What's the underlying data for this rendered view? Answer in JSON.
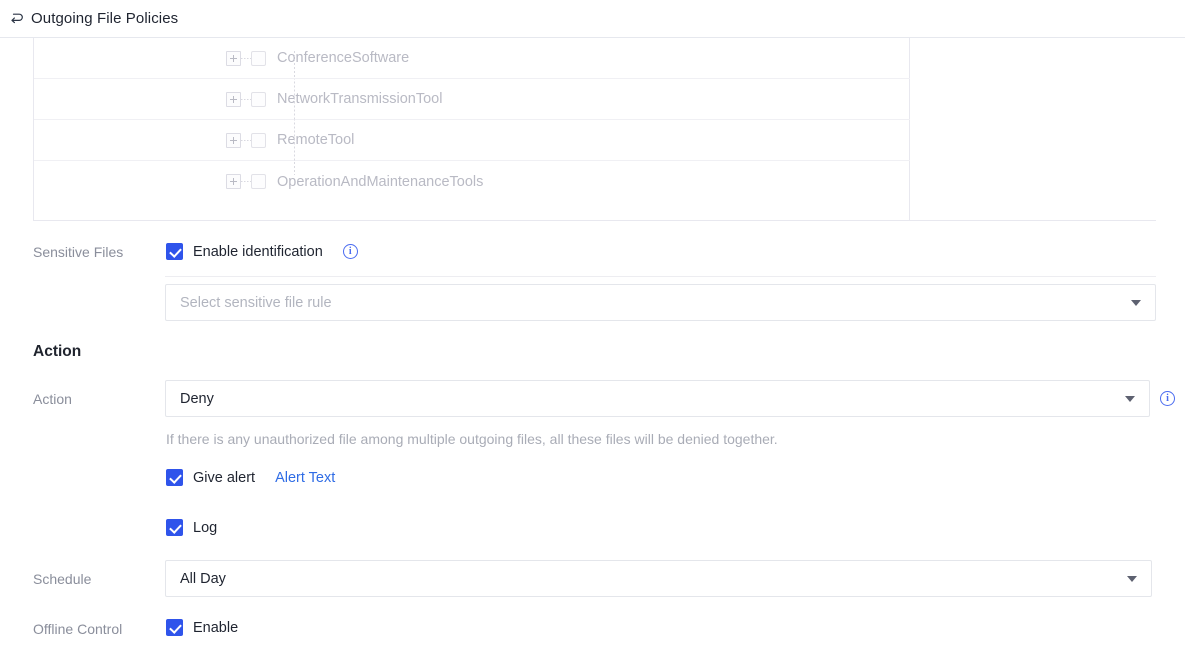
{
  "header": {
    "back_icon": "back-arrow-icon",
    "title": "Outgoing File Policies"
  },
  "tree": {
    "items": [
      {
        "label": "ConferenceSoftware",
        "expander": "plus-icon",
        "checked": false
      },
      {
        "label": "NetworkTransmissionTool",
        "expander": "plus-icon",
        "checked": false
      },
      {
        "label": "RemoteTool",
        "expander": "plus-icon",
        "checked": false
      },
      {
        "label": "OperationAndMaintenanceTools",
        "expander": "plus-icon",
        "checked": false
      }
    ]
  },
  "form": {
    "sensitive_files": {
      "label": "Sensitive Files",
      "enable_identification_label": "Enable identification",
      "enable_identification_checked": true,
      "info_icon": "info-icon",
      "rule_select_placeholder": "Select sensitive file rule",
      "rule_select_value": ""
    },
    "action_section": {
      "section_title": "Action",
      "label": "Action",
      "value": "Deny",
      "info_icon": "info-icon",
      "help_text": "If there is any unauthorized file among multiple outgoing files, all these files will be denied together.",
      "give_alert_label": "Give alert",
      "give_alert_checked": true,
      "alert_text_link": "Alert Text",
      "log_label": "Log",
      "log_checked": true
    },
    "schedule": {
      "label": "Schedule",
      "value": "All Day"
    },
    "offline_control": {
      "label": "Offline Control",
      "enable_label": "Enable",
      "enable_checked": true
    }
  },
  "colors": {
    "accent": "#2f54eb",
    "link": "#2f6ce5",
    "text": "#1f2430",
    "muted": "#8a8e9b"
  }
}
